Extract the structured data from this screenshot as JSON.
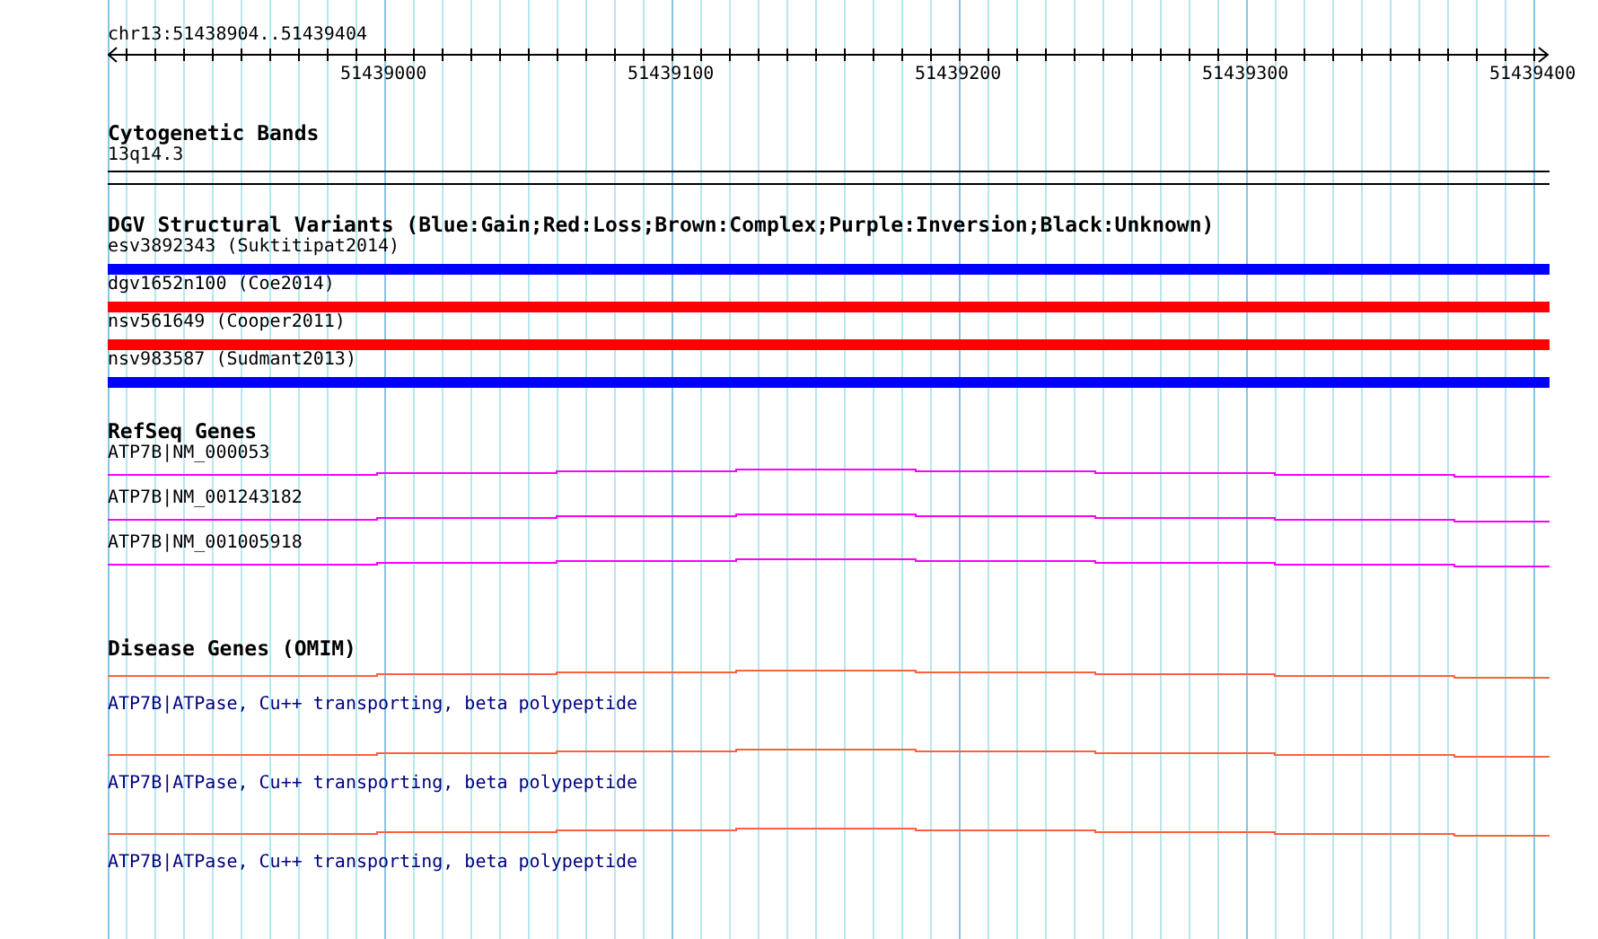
{
  "ruler": {
    "range": "chr13:51438904..51439404",
    "ticks": [
      "51439000",
      "51439100",
      "51439200",
      "51439300",
      "51439400"
    ]
  },
  "tracks": [
    {
      "kind": "bands",
      "title": "Cytogenetic Bands",
      "features": [
        {
          "label": "13q14.3"
        }
      ]
    },
    {
      "kind": "variants",
      "title": "DGV Structural Variants (Blue:Gain;Red:Loss;Brown:Complex;Purple:Inversion;Black:Unknown)",
      "features": [
        {
          "label": "esv3892343 (Suktitipat2014)",
          "color": "#0000ff"
        },
        {
          "label": "dgv1652n100 (Coe2014)",
          "color": "#ff0000"
        },
        {
          "label": "nsv561649 (Cooper2011)",
          "color": "#ff0000"
        },
        {
          "label": "nsv983587 (Sudmant2013)",
          "color": "#0000ff"
        }
      ]
    },
    {
      "kind": "genes",
      "title": "RefSeq Genes",
      "features": [
        {
          "label": "ATP7B|NM_000053"
        },
        {
          "label": "ATP7B|NM_001243182"
        },
        {
          "label": "ATP7B|NM_001005918"
        }
      ]
    },
    {
      "kind": "disease",
      "title": "Disease Genes (OMIM)",
      "features": [
        {
          "label": "ATP7B|ATPase, Cu++ transporting, beta polypeptide"
        },
        {
          "label": "ATP7B|ATPase, Cu++ transporting, beta polypeptide"
        },
        {
          "label": "ATP7B|ATPase, Cu++ transporting, beta polypeptide"
        }
      ]
    }
  ]
}
